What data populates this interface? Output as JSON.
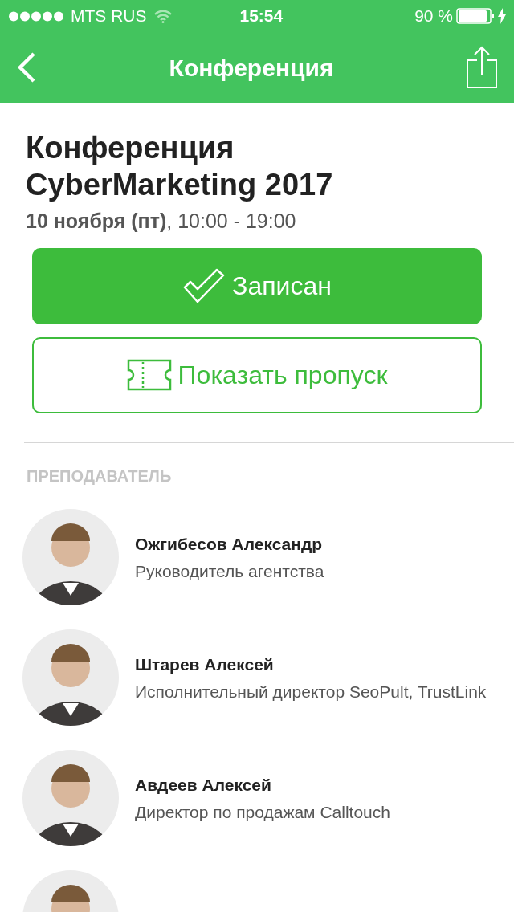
{
  "status_bar": {
    "carrier": "MTS RUS",
    "time": "15:54",
    "battery_text": "90 %",
    "charging": true
  },
  "nav_bar": {
    "title": "Конференция"
  },
  "event": {
    "title": "Конференция CyberMarketing 2017",
    "date": "**10 ноября (пт)**, 10:00 - 19:00"
  },
  "buttons": [
    {
      "kind": "filled",
      "label": "Записан"
    },
    {
      "kind": "outline",
      "label": "Показать пропуск"
    }
  ],
  "section": {
    "heading": "ПРЕПОДАВАТЕЛЬ"
  },
  "speakers": [
    {
      "name": "Ожгибесов Александр",
      "role": "Руководитель агентства",
      "avatar": {
        "kind": "picture"
      }
    },
    {
      "name": "Штарев Алексей",
      "role": "Исполнительный директор SeoPult, TrustLink",
      "avatar": {
        "kind": "picture"
      }
    },
    {
      "name": "Авдеев Алексей",
      "role": "Директор по продажам Calltouch",
      "avatar": {
        "kind": "picture"
      }
    },
    {
      "avatar": {
        "kind": "picture"
      }
    }
  ]
}
